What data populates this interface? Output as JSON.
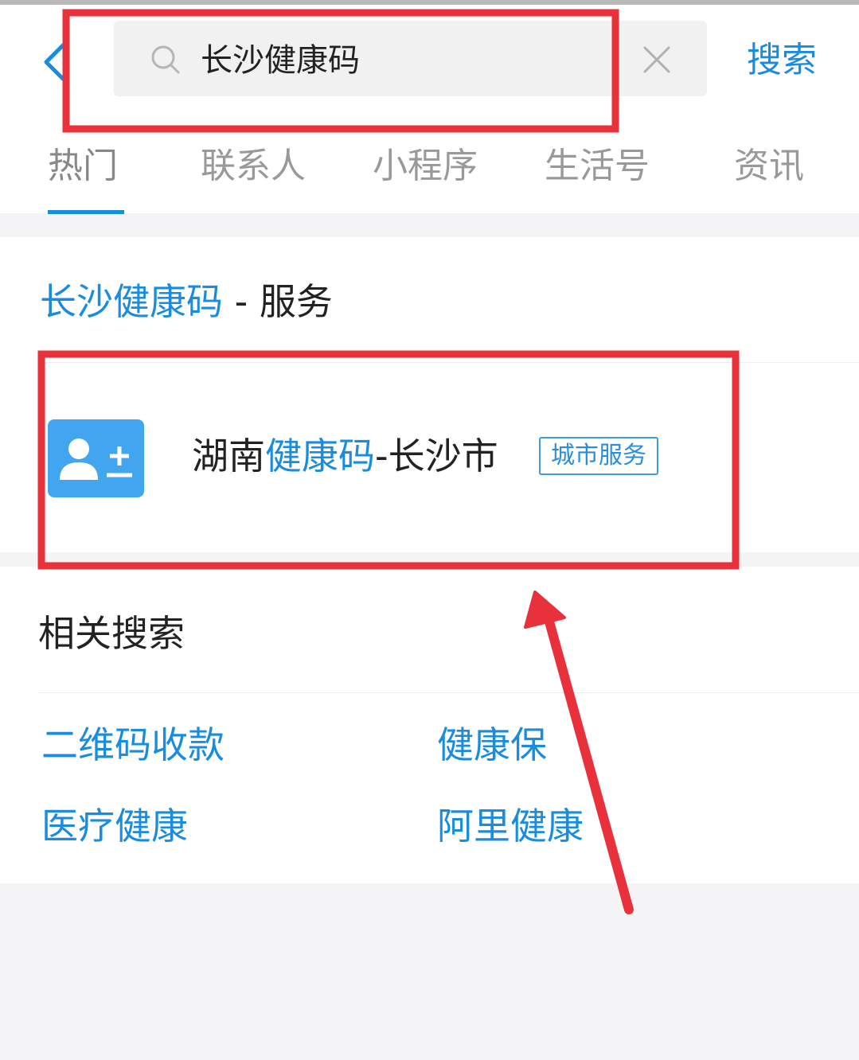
{
  "search": {
    "query": "长沙健康码",
    "button_label": "搜索"
  },
  "tabs": [
    {
      "label": "热门",
      "active": true
    },
    {
      "label": "联系人",
      "active": false
    },
    {
      "label": "小程序",
      "active": false
    },
    {
      "label": "生活号",
      "active": false
    },
    {
      "label": "资讯",
      "active": false
    }
  ],
  "service_section": {
    "title_highlight": "长沙健康码",
    "title_suffix": " - 服务",
    "result": {
      "prefix": "湖南",
      "highlight": "健康码",
      "suffix": "-长沙市",
      "badge": "城市服务",
      "icon": "add-contact-icon"
    }
  },
  "related_search": {
    "title": "相关搜索",
    "items": [
      "二维码收款",
      "健康保",
      "医疗健康",
      "阿里健康"
    ]
  },
  "colors": {
    "accent": "#1a8ce0",
    "annotation_red": "#e8313a",
    "icon_bg": "#42a5f0"
  }
}
